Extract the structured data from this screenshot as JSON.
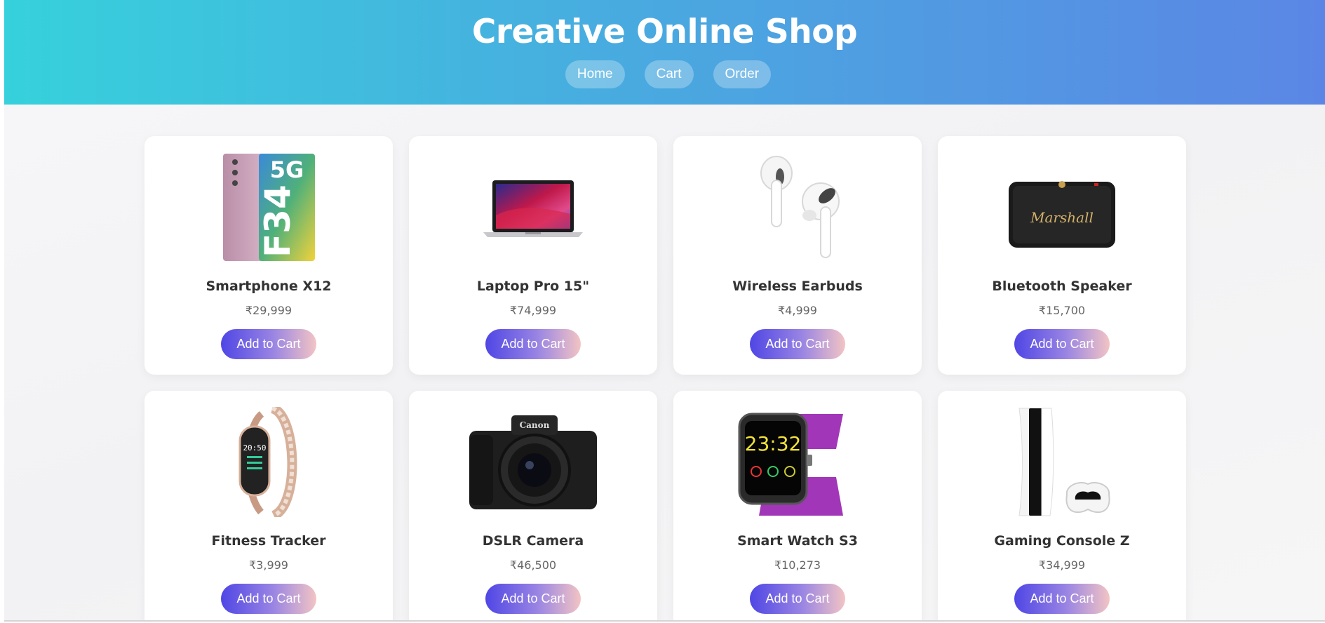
{
  "header": {
    "title": "Creative Online Shop",
    "nav": [
      "Home",
      "Cart",
      "Order"
    ]
  },
  "products": [
    {
      "name": "Smartphone X12",
      "price": "₹29,999",
      "button": "Add to Cart",
      "icon": "smartphone-image"
    },
    {
      "name": "Laptop Pro 15\"",
      "price": "₹74,999",
      "button": "Add to Cart",
      "icon": "laptop-image"
    },
    {
      "name": "Wireless Earbuds",
      "price": "₹4,999",
      "button": "Add to Cart",
      "icon": "earbuds-image"
    },
    {
      "name": "Bluetooth Speaker",
      "price": "₹15,700",
      "button": "Add to Cart",
      "icon": "speaker-image"
    },
    {
      "name": "Fitness Tracker",
      "price": "₹3,999",
      "button": "Add to Cart",
      "icon": "fitness-tracker-image"
    },
    {
      "name": "DSLR Camera",
      "price": "₹46,500",
      "button": "Add to Cart",
      "icon": "camera-image"
    },
    {
      "name": "Smart Watch S3",
      "price": "₹10,273",
      "button": "Add to Cart",
      "icon": "smartwatch-image"
    },
    {
      "name": "Gaming Console Z",
      "price": "₹34,999",
      "button": "Add to Cart",
      "icon": "console-image"
    }
  ],
  "image_text": {
    "phone_badge": "5G",
    "phone_model": "F34",
    "speaker_brand": "Marshall",
    "camera_brand": "Canon",
    "tracker_time": "20:50",
    "watch_time": "23:32"
  },
  "colors": {
    "header_start": "#36d1dc",
    "header_end": "#5b86e5",
    "button_start": "#4f46e5",
    "button_end": "#f2c4c4"
  }
}
